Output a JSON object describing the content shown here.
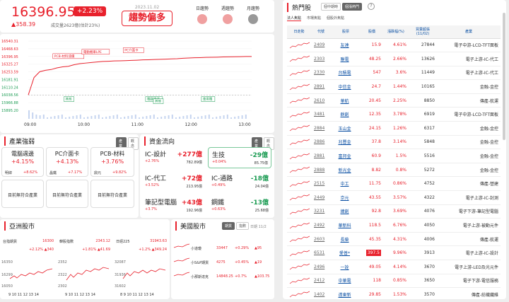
{
  "index": {
    "value": "16396.95",
    "change_pct": "+2.23%",
    "change_pts": "▲358.39",
    "volume": "成交量2623億(估計23%)",
    "date": "2023.11.02",
    "trend_label": "趨勢偏多",
    "trends": [
      {
        "label": "日趨勢",
        "color": "#f0a0a0"
      },
      {
        "label": "週趨勢",
        "color": "#f0a0a0"
      },
      {
        "label": "月趨勢",
        "color": "#999999"
      }
    ]
  },
  "chart_data": {
    "type": "line",
    "x_ticks": [
      "09:00",
      "10:00",
      "11:00",
      "12:00",
      "13:00"
    ],
    "y_ticks": [
      "16540.31",
      "16468.63",
      "16396.95",
      "16325.27",
      "16253.59",
      "16181.91",
      "16110.24",
      "16038.56",
      "15966.88",
      "15895.20"
    ],
    "ylim": [
      15895.2,
      16540.31
    ],
    "series": [
      {
        "values": [
          16038,
          16200,
          16255,
          16268,
          16275,
          16290,
          16300,
          16305,
          16320,
          16330,
          16335,
          16340,
          16345,
          16350,
          16352,
          16355,
          16356,
          16358,
          16360,
          16362,
          16365,
          16366,
          16368,
          16370,
          16372,
          16374,
          16376,
          16380,
          16382,
          16385,
          16386,
          16388,
          16389,
          16390,
          16392,
          16393,
          16394,
          16395,
          16396,
          16396
        ]
      }
    ],
    "annotations": [
      {
        "label": "PCB-材料漲價",
        "x": 0.22,
        "y": 16390
      },
      {
        "label": "電動機車LPE",
        "x": 0.48,
        "y": 16430
      },
      {
        "label": "PC介面卡",
        "x": 0.85,
        "y": 16445
      },
      {
        "label": "其他",
        "x": 0.32,
        "y": 15990
      },
      {
        "label": "電腦週邊",
        "x": 1.05,
        "y": 15990
      },
      {
        "label": "其他",
        "x": 1.12,
        "y": 15970
      },
      {
        "label": "車用電",
        "x": 1.55,
        "y": 15990
      }
    ]
  },
  "industry": {
    "title": "產業強弱",
    "tabs": [
      "產業",
      "概念"
    ],
    "cards": [
      {
        "name": "電腦週邊",
        "pct": "+4.15%",
        "stock": "明緯",
        "stock_pct": "+8.62%"
      },
      {
        "name": "PC介面卡",
        "pct": "+4.13%",
        "stock": "晶鐵",
        "stock_pct": "+7.17%"
      },
      {
        "name": "PCB-材料",
        "pct": "+3.76%",
        "stock": "鼎元",
        "stock_pct": "+9.82%"
      }
    ],
    "empty_label": "目前無符合產業"
  },
  "funds": {
    "title": "資金流向",
    "tabs": [
      "產業",
      "概念"
    ],
    "items": [
      {
        "name": "IC-設計",
        "val": "+277億",
        "pct": "+2.76%",
        "sub": "782.89億",
        "color": "red"
      },
      {
        "name": "生技",
        "val": "-29億",
        "pct": "+0.04%",
        "sub": "85.75億",
        "color": "green"
      },
      {
        "name": "IC-代工",
        "val": "+72億",
        "pct": "+3.52%",
        "sub": "213.95億",
        "color": "red"
      },
      {
        "name": "IC-通路",
        "val": "-18億",
        "pct": "+0.49%",
        "sub": "24.04億",
        "color": "green"
      },
      {
        "name": "筆記型電腦",
        "val": "+43億",
        "pct": "+3.7%",
        "sub": "192.96億",
        "color": "red"
      },
      {
        "name": "鋼鐵",
        "val": "-13億",
        "pct": "+0.63%",
        "sub": "25.68億",
        "color": "green"
      }
    ]
  },
  "asia": {
    "title": "亞洲股市",
    "markets": [
      {
        "name": "台指期貨",
        "val": "16300",
        "chg": "+2.12%  ▲340",
        "ylow": "16050",
        "yhigh": "16350",
        "ymid": "16299",
        "ticks": "9  10  11  12  13  14"
      },
      {
        "name": "韓股指數",
        "val": "2343.12",
        "chg": "+1.81%  ▲41.69",
        "ylow": "2302",
        "yhigh": "2352",
        "ymid": "2322",
        "ticks": "9  10  11  12  13  14"
      },
      {
        "name": "日經225",
        "val": "31943.63",
        "chg": "+1.2%  ▲349.24",
        "ylow": "31602",
        "yhigh": "32087",
        "ymid": "31936",
        "ticks": "8  9  10  11  12  13  14"
      }
    ]
  },
  "us": {
    "title": "美國股市",
    "tabs": [
      "期貨",
      "指數"
    ],
    "date": "日期 11/2",
    "rows": [
      {
        "name": "小道瓊",
        "val": "33447",
        "pct": "+0.29%",
        "pts": "▲95"
      },
      {
        "name": "小S&P期貨",
        "val": "4275",
        "pct": "+0.45%",
        "pts": "▲19"
      },
      {
        "name": "小那斯達克",
        "val": "14848.25",
        "pct": "+0.7%",
        "pts": "▲103.75"
      }
    ]
  },
  "hot": {
    "title": "熱門股",
    "tabs": [
      "個中期時",
      "個漲熱門"
    ],
    "help": "?",
    "subtabs": [
      "法人焦點",
      "市場焦點",
      "個股外焦點"
    ],
    "headers": [
      "日走勢",
      "代號",
      "股票",
      "股價",
      "漲跌幅(%)",
      "買賣超張\n(11/02)",
      "產業"
    ],
    "rows": [
      {
        "code": "2409",
        "name": "友達",
        "price": "15.9",
        "pct": "4.61%",
        "vol": "27844",
        "ind": "電子中游-LCD-TFT面板"
      },
      {
        "code": "2303",
        "name": "聯電",
        "price": "48.25",
        "pct": "2.66%",
        "vol": "13626",
        "ind": "電子上游-IC-代工"
      },
      {
        "code": "2330",
        "name": "台積電",
        "price": "547",
        "pct": "3.6%",
        "vol": "11449",
        "ind": "電子上游-IC-代工"
      },
      {
        "code": "2891",
        "name": "中信金",
        "price": "24.7",
        "pct": "1.44%",
        "vol": "10165",
        "ind": "金融-金控"
      },
      {
        "code": "2610",
        "name": "華航",
        "price": "20.45",
        "pct": "2.25%",
        "vol": "8850",
        "ind": "傳產-航運"
      },
      {
        "code": "3481",
        "name": "群創",
        "price": "12.35",
        "pct": "3.78%",
        "vol": "6919",
        "ind": "電子中游-LCD-TFT面板"
      },
      {
        "code": "2884",
        "name": "玉山金",
        "price": "24.15",
        "pct": "1.26%",
        "vol": "6317",
        "ind": "金融-金控"
      },
      {
        "code": "2886",
        "name": "兆豐金",
        "price": "37.8",
        "pct": "3.14%",
        "vol": "5848",
        "ind": "金融-金控"
      },
      {
        "code": "2881",
        "name": "富邦金",
        "price": "60.9",
        "pct": "1.5%",
        "vol": "5516",
        "ind": "金融-金控"
      },
      {
        "code": "2888",
        "name": "新光金",
        "price": "8.82",
        "pct": "0.8%",
        "vol": "5272",
        "ind": "金融-金控"
      },
      {
        "code": "2515",
        "name": "中工",
        "price": "11.75",
        "pct": "0.86%",
        "vol": "4752",
        "ind": "傳產-營建"
      },
      {
        "code": "2449",
        "name": "京元",
        "price": "43.55",
        "pct": "3.57%",
        "vol": "4322",
        "ind": "電子上游-IC-封測"
      },
      {
        "code": "3231",
        "name": "緯創",
        "price": "92.8",
        "pct": "3.69%",
        "vol": "4076",
        "ind": "電子下游-筆記型電腦"
      },
      {
        "code": "2492",
        "name": "華新科",
        "price": "118.5",
        "pct": "6.76%",
        "vol": "4050",
        "ind": "電子上游-被動元件"
      },
      {
        "code": "2603",
        "name": "長榮",
        "price": "45.35",
        "pct": "4.31%",
        "vol": "4006",
        "ind": "傳產-航運"
      },
      {
        "code": "6531",
        "name": "愛普*",
        "price": "397.5",
        "pct": "9.96%",
        "vol": "3913",
        "ind": "電子上游-IC-設計",
        "hl": true
      },
      {
        "code": "2496",
        "name": "一詮",
        "price": "49.05",
        "pct": "4.14%",
        "vol": "3670",
        "ind": "電子上游-LED及光元件"
      },
      {
        "code": "2412",
        "name": "中華電",
        "price": "118",
        "pct": "0.85%",
        "vol": "3650",
        "ind": "電子下游-電信服務"
      },
      {
        "code": "1402",
        "name": "遠東新",
        "price": "29.85",
        "pct": "1.53%",
        "vol": "3570",
        "ind": "傳產-紡織纖維"
      }
    ]
  }
}
